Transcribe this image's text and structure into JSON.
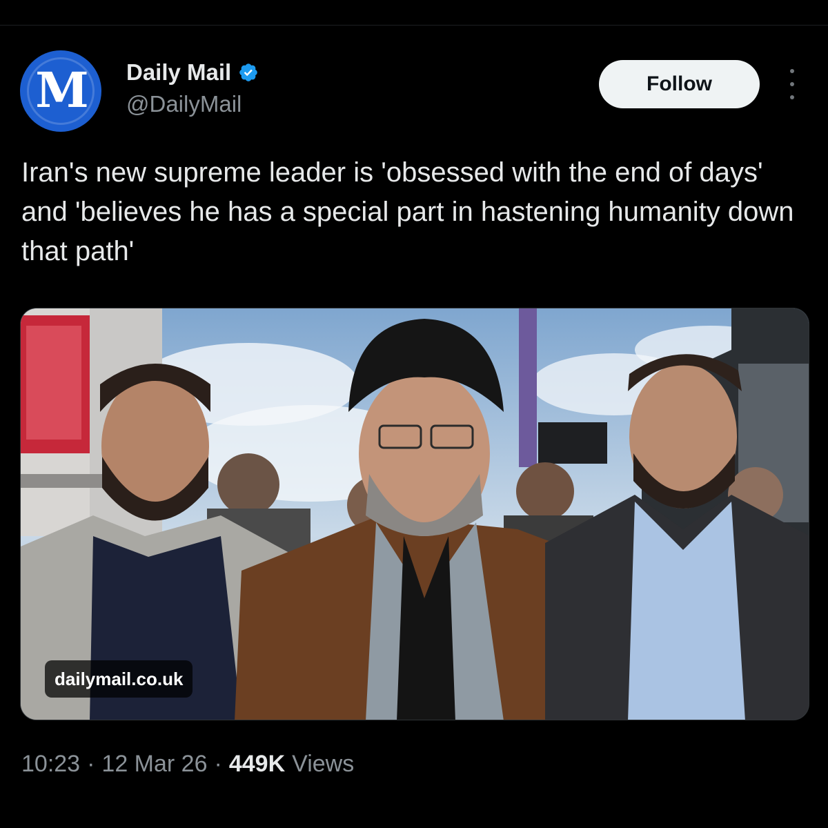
{
  "account": {
    "name": "Daily Mail",
    "handle": "@DailyMail",
    "avatar_glyph": "M",
    "avatar_color": "#1d5fd1",
    "verified_color": "#1d9bf0",
    "verified_icon": "verified-badge-icon"
  },
  "actions": {
    "follow_label": "Follow",
    "more_icon": "more-vertical-icon"
  },
  "tweet": {
    "text": "Iran's new supreme leader is 'obsessed with the end of days' and 'believes he has a special part in hastening humanity down that path'",
    "link_domain": "dailymail.co.uk"
  },
  "footer": {
    "time": "10:23",
    "separator": "·",
    "date": "12 Mar 26",
    "views_count": "449K",
    "views_label": "Views"
  }
}
